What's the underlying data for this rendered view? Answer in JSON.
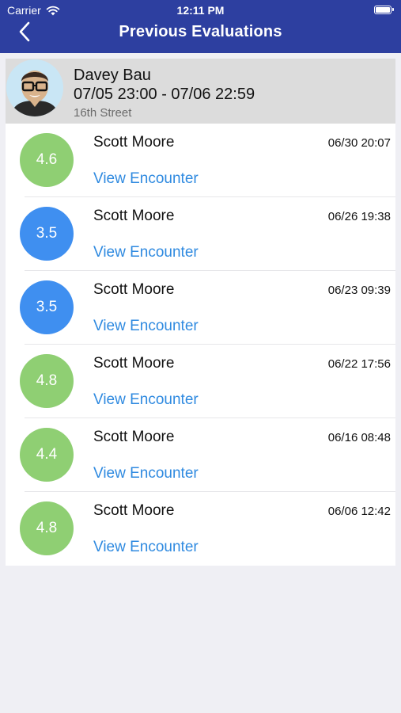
{
  "status_bar": {
    "carrier": "Carrier",
    "time": "12:11 PM"
  },
  "nav": {
    "title": "Previous Evaluations"
  },
  "profile": {
    "name": "Davey Bau",
    "range": "07/05 23:00 - 07/06 22:59",
    "location": "16th Street"
  },
  "colors": {
    "header": "#2d3fa0",
    "score_green": "#8fcf73",
    "score_blue": "#3f8ff0",
    "link": "#2f8ae0"
  },
  "evaluations": [
    {
      "score": "4.6",
      "color": "green",
      "name": "Scott Moore",
      "date": "06/30 20:07",
      "link": "View Encounter"
    },
    {
      "score": "3.5",
      "color": "blue",
      "name": "Scott Moore",
      "date": "06/26 19:38",
      "link": "View Encounter"
    },
    {
      "score": "3.5",
      "color": "blue",
      "name": "Scott Moore",
      "date": "06/23 09:39",
      "link": "View Encounter"
    },
    {
      "score": "4.8",
      "color": "green",
      "name": "Scott Moore",
      "date": "06/22 17:56",
      "link": "View Encounter"
    },
    {
      "score": "4.4",
      "color": "green",
      "name": "Scott Moore",
      "date": "06/16 08:48",
      "link": "View Encounter"
    },
    {
      "score": "4.8",
      "color": "green",
      "name": "Scott Moore",
      "date": "06/06 12:42",
      "link": "View Encounter"
    }
  ]
}
